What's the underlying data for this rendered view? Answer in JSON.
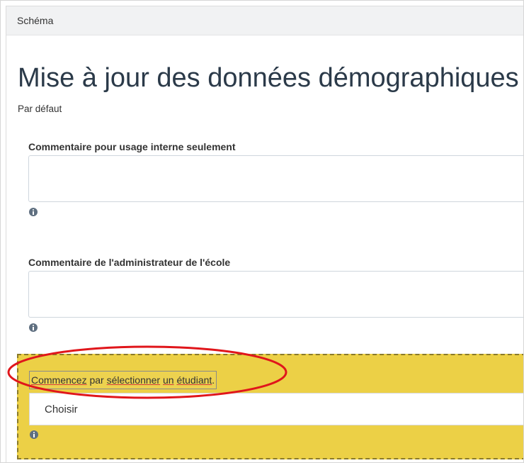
{
  "topbar": {
    "title": "Schéma"
  },
  "page": {
    "title": "Mise à jour des données démographiques",
    "subtitle": "Par défaut"
  },
  "fields": [
    {
      "label": "Commentaire pour usage interne seulement",
      "value": ""
    },
    {
      "label": "Commentaire de l'administrateur de l'école",
      "value": ""
    }
  ],
  "student": {
    "label_parts": [
      "Commencez",
      " par ",
      "sélectionner",
      " ",
      "un",
      " ",
      "étudiant",
      "."
    ],
    "select_value": "Choisir"
  },
  "annotation": {
    "color": "#e0161b"
  },
  "icons": {
    "info": "info-icon"
  }
}
